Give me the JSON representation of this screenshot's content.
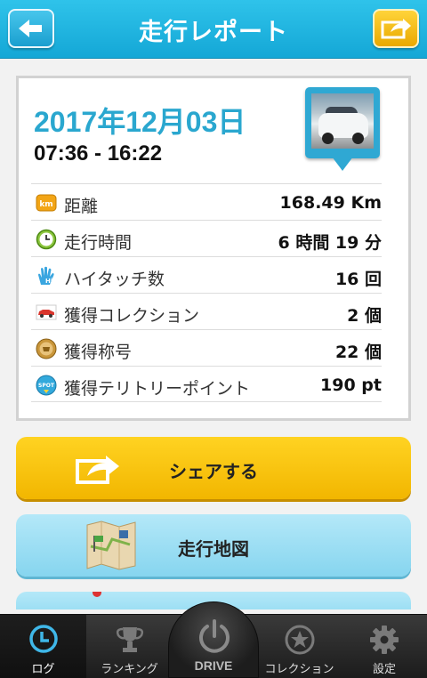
{
  "header": {
    "title": "走行レポート",
    "back_icon": "back-arrow-icon",
    "share_icon": "share-icon"
  },
  "report": {
    "date": "2017年12月03日",
    "time_range": "07:36 - 16:22",
    "rows": [
      {
        "icon": "km-icon",
        "label": "距離",
        "value": "168.49 Km"
      },
      {
        "icon": "clock-icon",
        "label": "走行時間",
        "value": "6 時間 19 分"
      },
      {
        "icon": "hi-five-icon",
        "label": "ハイタッチ数",
        "value": "16 回"
      },
      {
        "icon": "car-icon",
        "label": "獲得コレクション",
        "value": "2 個"
      },
      {
        "icon": "title-medal-icon",
        "label": "獲得称号",
        "value": "22 個"
      },
      {
        "icon": "spot-icon",
        "label": "獲得テリトリーポイント",
        "value": "190 pt"
      }
    ]
  },
  "actions": {
    "share_label": "シェアする",
    "map_label": "走行地図"
  },
  "tabbar": {
    "log": "ログ",
    "ranking": "ランキング",
    "drive": "DRIVE",
    "collection": "コレクション",
    "settings": "設定"
  },
  "colors": {
    "header": "#1ab0dd",
    "date": "#2aa7cf",
    "share_button": "#f7c40a",
    "map_button": "#9ddff4",
    "tabbar": "#262626"
  }
}
